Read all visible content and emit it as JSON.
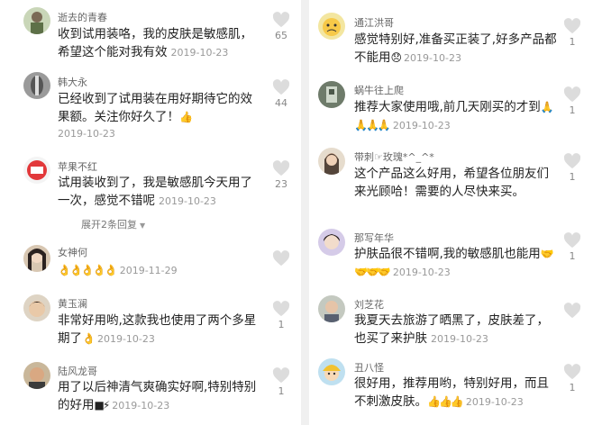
{
  "left_comments": [
    {
      "user": "逝去的青春",
      "lines": [
        "收到试用装咯，我的皮肤是敏感肌，",
        "希望这个能对我有效"
      ],
      "date": "2019-10-23",
      "likes": "65"
    },
    {
      "user": "韩大永",
      "lines": [
        "已经收到了试用装在用好期待它的效",
        "果额。关注你好久了！"
      ],
      "emoji": "👍",
      "date": "2019-10-23",
      "likes": "44"
    },
    {
      "user": "苹果不红",
      "lines": [
        "试用装收到了，我是敏感肌今天用了",
        "一次，感觉不错呢"
      ],
      "date": "2019-10-23",
      "likes": "23",
      "expand": "展开2条回复"
    },
    {
      "user": "女神何",
      "lines": [],
      "emoji": "👌👌👌👌👌",
      "date": "2019-11-29",
      "likes": ""
    },
    {
      "user": "黄玉澜",
      "lines": [
        "非常好用哟,这款我也使用了两个多星",
        "期了"
      ],
      "emoji": "👌",
      "date": "2019-10-23",
      "likes": "1"
    },
    {
      "user": "陆风龙哥",
      "lines": [
        "用了以后神清气爽确实好啊,特别特别",
        "的好用"
      ],
      "emoji": "■⚡",
      "date": "2019-10-23",
      "likes": "1"
    }
  ],
  "right_comments": [
    {
      "user": "通江洪哥",
      "lines": [
        "感觉特别好,准备买正装了,好多产品都",
        "不能用"
      ],
      "emoji": "😞",
      "date": "2019-10-23",
      "likes": "1"
    },
    {
      "user": "蜗牛往上爬",
      "lines": [
        "推荐大家使用哦,前几天刚买的才到"
      ],
      "emoji": "🙏",
      "emoji2": "🙏🙏🙏",
      "date": "2019-10-23",
      "likes": "1"
    },
    {
      "user": "带刺☞玫瑰*^_^*",
      "lines": [
        "这个产品这么好用，希望各位朋友们",
        "来光顾哈！需要的人尽快来买。"
      ],
      "date": "",
      "likes": "1"
    },
    {
      "user": "那写年华",
      "lines": [
        "护肤品很不错啊,我的敏感肌也能用"
      ],
      "emoji": "🤝",
      "emoji2": "🤝🤝🤝",
      "date": "2019-10-23",
      "likes": "1"
    },
    {
      "user": "刘芝花",
      "lines": [
        "我夏天去旅游了晒黑了，皮肤差了，",
        "也买了来护肤"
      ],
      "date": "2019-10-23",
      "likes": ""
    },
    {
      "user": "丑八怪",
      "lines": [
        "很好用，推荐用哟，特别好用，而且",
        "不刺激皮肤。"
      ],
      "emoji": "👍👍👍",
      "date": "2019-10-23",
      "likes": "1"
    }
  ],
  "icons": {
    "like": "heart-icon",
    "expand": "chevron-down-icon",
    "avatar": "avatar"
  },
  "colors": {
    "heart": "#dcdcdc",
    "date": "#999999",
    "username": "#666666",
    "text": "#222222"
  }
}
